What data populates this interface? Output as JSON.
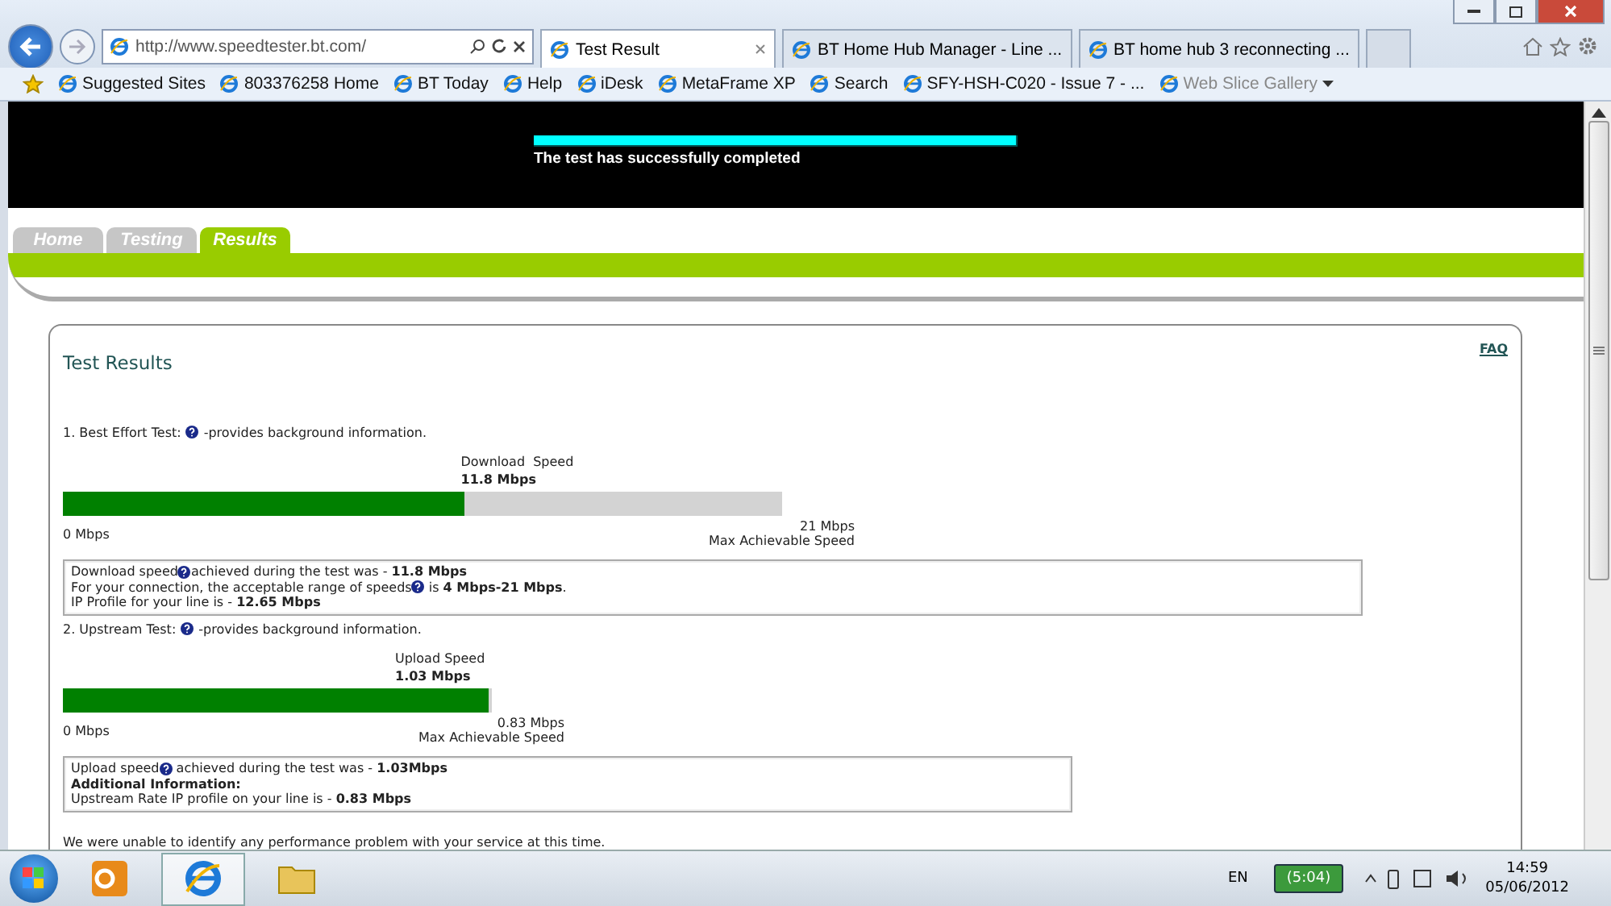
{
  "address": {
    "url": "http://www.speedtester.bt.com/"
  },
  "tabs": [
    {
      "label": "Test Result",
      "selected": true
    },
    {
      "label": "BT Home Hub Manager - Line ...",
      "selected": false
    },
    {
      "label": "BT home hub 3 reconnecting ...",
      "selected": false
    }
  ],
  "favorites": [
    {
      "label": "Suggested Sites",
      "dimmed": false
    },
    {
      "label": "803376258 Home",
      "dimmed": false
    },
    {
      "label": "BT Today",
      "dimmed": false
    },
    {
      "label": "Help",
      "dimmed": false
    },
    {
      "label": "iDesk",
      "dimmed": false
    },
    {
      "label": "MetaFrame XP",
      "dimmed": false
    },
    {
      "label": "Search",
      "dimmed": false
    },
    {
      "label": "SFY-HSH-C020 - Issue 7 - ...",
      "dimmed": false
    },
    {
      "label": "Web Slice Gallery",
      "dimmed": true
    }
  ],
  "banner": {
    "level": 1,
    "message": "The test has successfully completed"
  },
  "nav_tabs": [
    {
      "label": "Home",
      "selected": false
    },
    {
      "label": "Testing",
      "selected": false
    },
    {
      "label": "Results",
      "selected": true
    }
  ],
  "card": {
    "title": "Test Results",
    "faq": "FAQ"
  },
  "tests": [
    {
      "heading": "1. Best Effort Test:",
      "hint": "-provides background information.",
      "meter_label": "Download  Speed",
      "value": "11.8 Mbps",
      "level": 0.56,
      "min": "0 Mbps",
      "max": "21 Mbps",
      "max_label": "Max Achievable Speed",
      "lines": [
        {
          "pre": "Download speed",
          "help": true,
          "post": "achieved during the test was - **11.8 Mbps**",
          "bold": false
        },
        {
          "pre": "For your connection, the acceptable range of speeds",
          "help": true,
          "post": " is **4 Mbps-21 Mbps**.",
          "bold": false
        },
        {
          "pre": "IP Profile for your line is - **12.65 Mbps**",
          "help": false,
          "bold": false
        }
      ]
    },
    {
      "heading": "2. Upstream Test:",
      "hint": "-provides background information.",
      "meter_label": "Upload Speed",
      "value": "1.03 Mbps",
      "level": 1,
      "min": "0 Mbps",
      "max": "0.83 Mbps",
      "max_label": "Max Achievable Speed",
      "lines": [
        {
          "pre": "Upload speed",
          "help": true,
          "post": " achieved during the test was - **1.03Mbps**",
          "bold": false
        },
        {
          "pre": "Additional Information:",
          "help": false,
          "bold": true
        },
        {
          "pre": "Upstream Rate IP profile on your line is - **0.83 Mbps**",
          "help": false,
          "bold": false
        }
      ]
    }
  ],
  "footer": "We were unable to identify any performance problem with your service at this time.",
  "taskbar": {
    "language": "EN",
    "battery": "(5:04)",
    "time": "14:59",
    "date": "05/06/2012"
  }
}
